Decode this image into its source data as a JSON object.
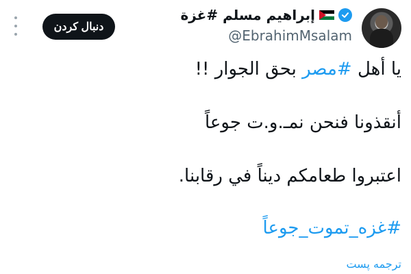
{
  "author": {
    "display_name": "إبراهيم مسلم #غزة",
    "handle": "@EbrahimMsalam",
    "verified_icon": "verified-badge-icon",
    "flag_icon": "palestine-flag-icon"
  },
  "actions": {
    "follow_label": "دنبال کردن",
    "more_icon": "more-vertical-icon"
  },
  "tweet": {
    "line1_prefix": "يا أهل ",
    "line1_hashtag": "#مصر",
    "line1_suffix": " بحق الجوار !!",
    "line2": "أنقذونا فنحن نمـ.و.ت جوعاً",
    "line3": "اعتبروا طعامكم ديناً في رقابنا.",
    "hashtag_line": "#غزه_تموت_جوعاً",
    "translate_label": "ترجمه پست"
  },
  "colors": {
    "link": "#1d9bf0",
    "text": "#0f1419",
    "muted": "#536471",
    "button": "#0f1419"
  }
}
